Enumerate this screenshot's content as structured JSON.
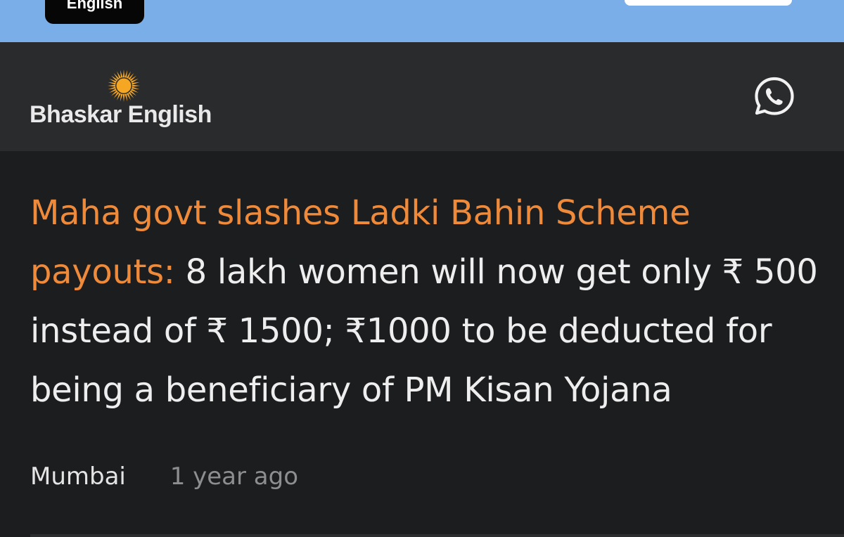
{
  "topbar": {
    "language_button_label": "English"
  },
  "header": {
    "brand_name": "Bhaskar English",
    "brand_color": "#f5a623",
    "share_icon": "whatsapp-icon"
  },
  "article": {
    "headline_highlight": "Maha govt slashes Ladki Bahin Scheme payouts:",
    "headline_rest": " 8 lakh women will now get only ₹ 500 instead of ₹ 1500; ₹1000 to be deducted for being a beneficiary of PM Kisan Yojana",
    "location": "Mumbai",
    "published": "1 year ago",
    "highlight_color": "#ef8a3a"
  }
}
